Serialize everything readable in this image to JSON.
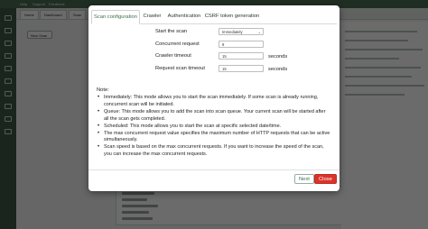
{
  "background": {
    "topbar_items": [
      "Help",
      "Support",
      "Feedback"
    ],
    "tabs": [
      "Home",
      "Dashboard",
      "Scan"
    ],
    "new_button": "New Scan"
  },
  "modal": {
    "tabs": [
      {
        "label": "Scan configuration",
        "active": true
      },
      {
        "label": "Crawler",
        "active": false
      },
      {
        "label": "Authentication",
        "active": false
      },
      {
        "label": "CSRF token generation",
        "active": false
      }
    ],
    "fields": {
      "start_scan": {
        "label": "Start the scan",
        "value": "Immediately"
      },
      "concurrent_request": {
        "label": "Concurrent request",
        "value": "8"
      },
      "crawler_timeout": {
        "label": "Crawler timeout",
        "value": "15",
        "unit": "seconds"
      },
      "request_scan_timeout": {
        "label": "Request scan timeout",
        "value": "15",
        "unit": "seconds"
      }
    },
    "note": {
      "title": "Note:",
      "items": [
        "Immediately: This mode allows you to start the scan immediately. If some scan is already running, concurrent scan will be initiated.",
        "Queue: This mode allows you to add the scan into scan queue. Your current scan will be started after all the scan gets completed.",
        "Scheduled: This mode allows you to start the scan at specific selected date/time.",
        "The max concurrent request value specifies the maximum number of HTTP requests that can be active simultaneously.",
        "Scan speed is based on the max concurrent requests. If you want to increase the speed of the scan, you can increase the max concurrent requests."
      ]
    },
    "buttons": {
      "next": "Next",
      "close": "Close"
    }
  },
  "colors": {
    "accent": "#3b6e4d",
    "danger": "#d9342b",
    "sidebar": "#3f5a48"
  }
}
